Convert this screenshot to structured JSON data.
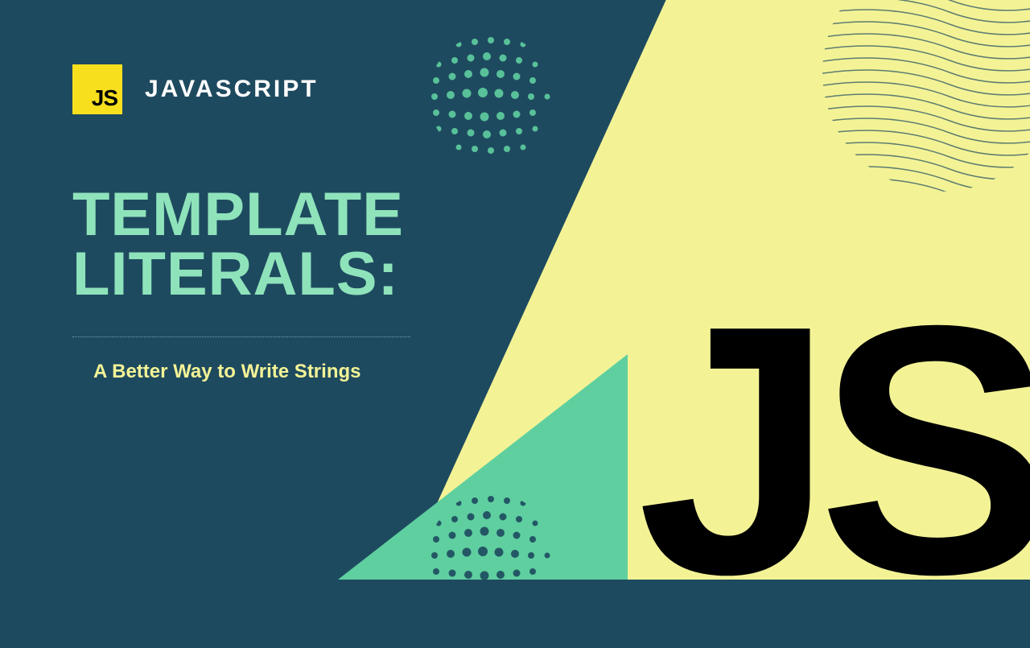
{
  "header": {
    "badge": "JS",
    "title": "JAVASCRIPT"
  },
  "main": {
    "title_line1": "TEMPLATE",
    "title_line2": "LITERALS:",
    "subtitle": "A Better Way to Write Strings"
  },
  "big_logo": "JS",
  "colors": {
    "bg_dark": "#1e4a5f",
    "bg_light": "#f3f396",
    "mint": "#5fcfa0",
    "accent_mint": "#8fe3bb",
    "js_yellow": "#f7df1e"
  }
}
